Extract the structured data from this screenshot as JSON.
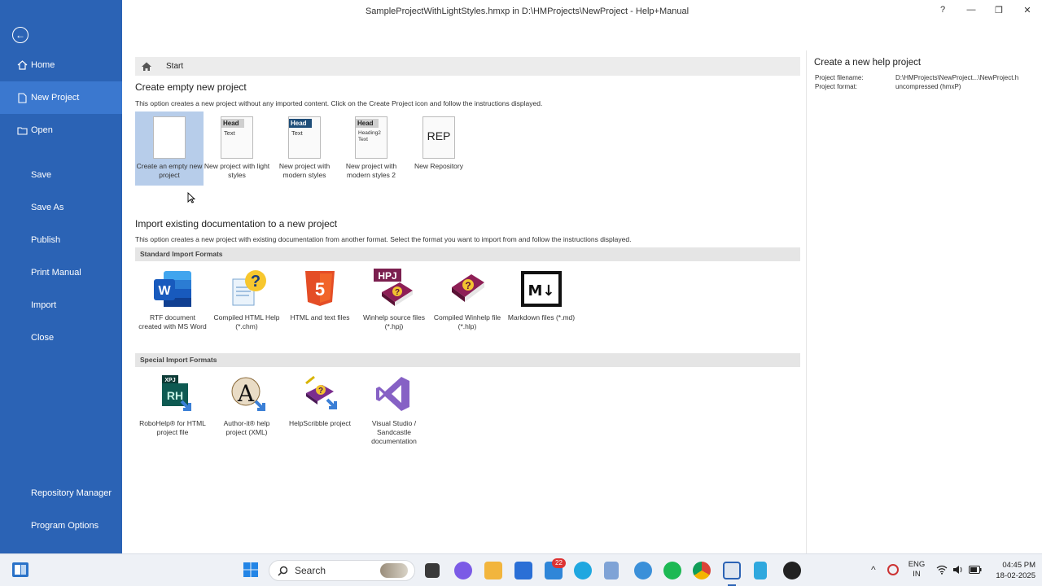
{
  "window": {
    "title": "SampleProjectWithLightStyles.hmxp in D:\\HMProjects\\NewProject - Help+Manual",
    "help_label": "?",
    "minimize_label": "—",
    "maximize_label": "❐",
    "close_label": "✕"
  },
  "sidebar": {
    "back_icon": "back-arrow-icon",
    "items": [
      {
        "label": "Home",
        "icon": "home-icon"
      },
      {
        "label": "New Project",
        "icon": "document-icon",
        "active": true
      },
      {
        "label": "Open",
        "icon": "folder-icon"
      },
      {
        "label": "Save"
      },
      {
        "label": "Save As"
      },
      {
        "label": "Publish"
      },
      {
        "label": "Print Manual"
      },
      {
        "label": "Import"
      },
      {
        "label": "Close"
      },
      {
        "label": "Repository Manager"
      },
      {
        "label": "Program Options"
      }
    ]
  },
  "breadcrumb": {
    "label": "Start"
  },
  "create": {
    "heading": "Create empty new project",
    "description": "This option creates a new project without any imported content. Click on the Create Project icon and follow the instructions displayed.",
    "tiles": [
      {
        "label": "Create an empty new project",
        "selected": true
      },
      {
        "label": "New project with light styles",
        "head": "Head",
        "text": "Text"
      },
      {
        "label": "New project with modern styles",
        "head": "Head",
        "text": "Text"
      },
      {
        "label": "New project with modern styles 2",
        "head": "Head",
        "text": "Heading2",
        "text2": "Text"
      },
      {
        "label": "New Repository",
        "rep": "REP"
      }
    ]
  },
  "import": {
    "heading": "Import existing documentation to a new project",
    "description": "This option creates a new project with existing documentation from another format. Select the format you want to import from and follow the instructions displayed.",
    "standard_title": "Standard Import Formats",
    "standard": [
      {
        "label": "RTF document created with MS Word",
        "icon": "word-icon"
      },
      {
        "label": "Compiled HTML Help (*.chm)",
        "icon": "chm-help-icon"
      },
      {
        "label": "HTML and text files",
        "icon": "html5-icon",
        "glyph": "5"
      },
      {
        "label": "Winhelp source files (*.hpj)",
        "icon": "hpj-book-icon",
        "badge": "HPJ"
      },
      {
        "label": "Compiled Winhelp file (*.hlp)",
        "icon": "hlp-book-icon"
      },
      {
        "label": "Markdown files (*.md)",
        "icon": "markdown-icon",
        "glyph": "M↓"
      }
    ],
    "special_title": "Special Import Formats",
    "special": [
      {
        "label": "RoboHelp® for HTML project file",
        "icon": "robohelp-icon",
        "badge": "XPJ",
        "glyph": "RH"
      },
      {
        "label": "Author-it® help project (XML)",
        "icon": "authorit-icon",
        "glyph": "A"
      },
      {
        "label": "HelpScribble project",
        "icon": "helpscribble-icon"
      },
      {
        "label": "Visual Studio / Sandcastle documentation",
        "icon": "visual-studio-icon"
      }
    ]
  },
  "right_panel": {
    "title": "Create a new help project",
    "rows": [
      {
        "label": "Project filename:",
        "value": "D:\\HMProjects\\NewProject...\\NewProject.h"
      },
      {
        "label": "Project format:",
        "value": "uncompressed (hmxP)"
      }
    ]
  },
  "taskbar": {
    "search_placeholder": "Search",
    "mail_badge": "22",
    "language": "ENG",
    "region": "IN",
    "time": "04:45 PM",
    "date": "18-02-2025"
  },
  "colors": {
    "sidebar": "#2b63b5",
    "sidebar_active": "#3b78cf",
    "selection": "#b7cdea"
  }
}
